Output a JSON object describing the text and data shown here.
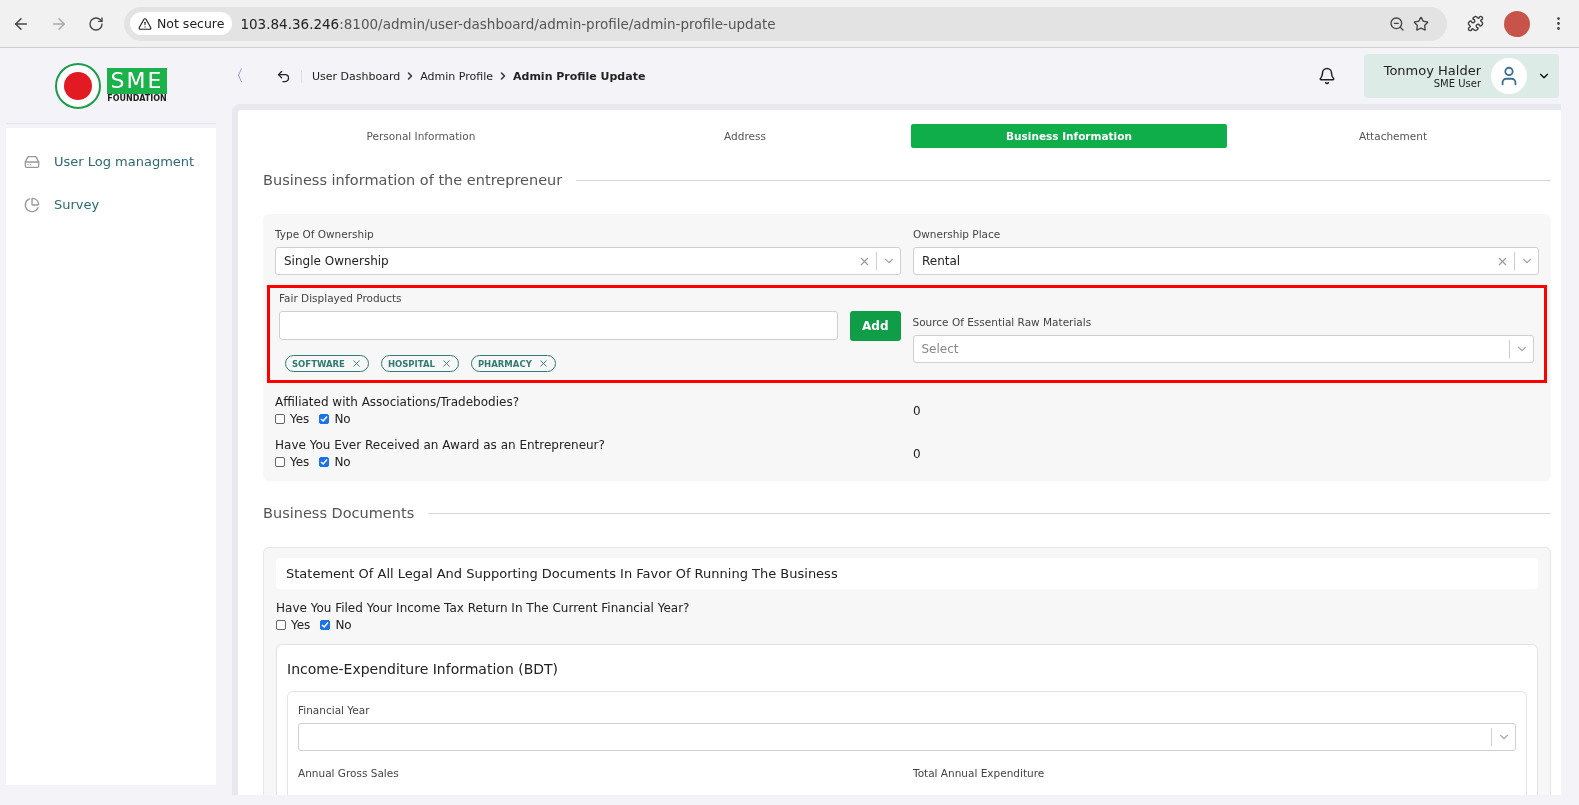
{
  "browser": {
    "security": "Not secure",
    "url_host": "103.84.36.246",
    "url_rest": ":8100/admin/user-dashboard/admin-profile/admin-profile-update"
  },
  "sidebar": {
    "logo_text": "SME",
    "logo_sub": "FOUNDATION",
    "items": [
      {
        "label": "User Log managment",
        "kind": "log"
      },
      {
        "label": "Survey",
        "kind": "chart"
      }
    ]
  },
  "header": {
    "collapse": "〈",
    "breadcrumbs": [
      "User Dashboard",
      "Admin Profile",
      "Admin Profile Update"
    ],
    "user": {
      "name": "Tonmoy Halder",
      "role": "SME User"
    }
  },
  "tabs": [
    {
      "label": "Personal Information",
      "selected": false
    },
    {
      "label": "Address",
      "selected": false
    },
    {
      "label": "Business Information",
      "selected": true
    },
    {
      "label": "Attachement",
      "selected": false
    }
  ],
  "business": {
    "title": "Business information of the entrepreneur",
    "type_of_ownership": {
      "label": "Type Of Ownership",
      "value": "Single Ownership"
    },
    "ownership_place": {
      "label": "Ownership Place",
      "value": "Rental"
    },
    "fair_products": {
      "label": "Fair Displayed Products",
      "button": "Add",
      "tags": [
        "SOFTWARE",
        "HOSPITAL",
        "PHARMACY"
      ]
    },
    "raw_materials": {
      "label": "Source Of Essential Raw Materials",
      "placeholder": "Select"
    },
    "questions": [
      {
        "question": "Affiliated with Associations/Tradebodies?",
        "options": [
          {
            "label": "Yes",
            "checked": false
          },
          {
            "label": "No",
            "checked": true
          }
        ],
        "value": "0"
      },
      {
        "question": "Have You Ever Received an Award as an Entrepreneur?",
        "options": [
          {
            "label": "Yes",
            "checked": false
          },
          {
            "label": "No",
            "checked": true
          }
        ],
        "value": "0"
      }
    ]
  },
  "documents": {
    "title": "Business Documents",
    "statement": "Statement Of All Legal And Supporting Documents In Favor Of Running The Business",
    "question": {
      "question": "Have You Filed Your Income Tax Return In The Current Financial Year?",
      "options": [
        {
          "label": "Yes",
          "checked": false
        },
        {
          "label": "No",
          "checked": true
        }
      ]
    },
    "income": {
      "title": "Income-Expenditure Information (BDT)",
      "financial_year": "Financial Year",
      "annual_gross_sales": "Annual Gross Sales",
      "total_annual_expenditure": "Total Annual Expenditure"
    }
  }
}
